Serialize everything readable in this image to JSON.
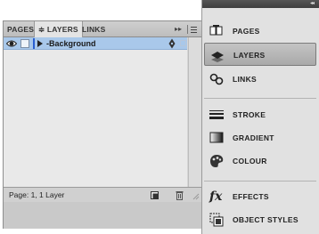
{
  "layers_panel": {
    "tabs": [
      {
        "label": "PAGES"
      },
      {
        "label": "≑ LAYERS",
        "active": true
      },
      {
        "label": "LINKS"
      }
    ],
    "tab_arrows": "▸▸",
    "layers": [
      {
        "name": "-Background",
        "visible": true,
        "locked": false,
        "color": "#2a5fd1",
        "selected": true
      }
    ],
    "status": "Page: 1, 1 Layer"
  },
  "dock": {
    "collapse_glyph": "◂◂",
    "groups": [
      [
        {
          "label": "PAGES",
          "icon": "pages-icon"
        },
        {
          "label": "LAYERS",
          "icon": "layers-icon",
          "active": true
        },
        {
          "label": "LINKS",
          "icon": "links-icon"
        }
      ],
      [
        {
          "label": "STROKE",
          "icon": "stroke-icon"
        },
        {
          "label": "GRADIENT",
          "icon": "gradient-icon"
        },
        {
          "label": "COLOUR",
          "icon": "colour-icon"
        }
      ],
      [
        {
          "label": "EFFECTS",
          "icon": "effects-icon",
          "glyph": "fx"
        },
        {
          "label": "OBJECT STYLES",
          "icon": "object-styles-icon"
        }
      ]
    ]
  }
}
